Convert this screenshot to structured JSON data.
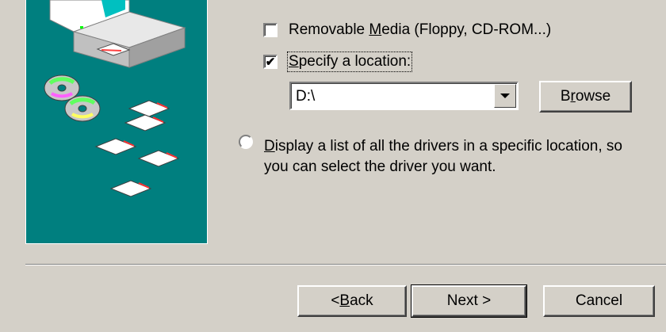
{
  "options": {
    "removable_media": {
      "pre": "Removable ",
      "mnemonic": "M",
      "post": "edia (Floppy, CD-ROM...)",
      "checked": false
    },
    "specify_location": {
      "mnemonic": "S",
      "post": "pecify a location:",
      "checked": true,
      "check_glyph": "✔"
    },
    "location_value": "D:\\",
    "browse_pre": "B",
    "browse_mnemonic": "r",
    "browse_post": "owse",
    "display_list": {
      "mnemonic": "D",
      "post": "isplay a list of all the drivers in a specific location, so you can select the driver you want.",
      "selected": false
    }
  },
  "buttons": {
    "back_pre": "< ",
    "back_mnemonic": "B",
    "back_post": "ack",
    "next": "Next >",
    "cancel": "Cancel"
  },
  "colors": {
    "face": "#d4d0c8",
    "teal_panel": "#007f7f"
  },
  "icons": [
    "computer-icon",
    "cd-disc-icon",
    "floppy-disk-icon",
    "dropdown-arrow-icon"
  ]
}
